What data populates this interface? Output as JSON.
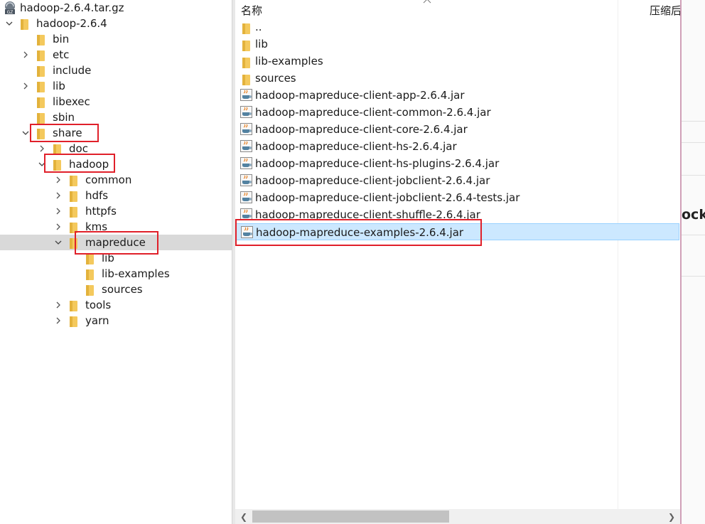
{
  "tree": {
    "root": "hadoop-2.6.4.tar.gz",
    "items": [
      {
        "label": "hadoop-2.6.4",
        "level": 0,
        "expander": "open"
      },
      {
        "label": "bin",
        "level": 1,
        "expander": "none"
      },
      {
        "label": "etc",
        "level": 1,
        "expander": "closed"
      },
      {
        "label": "include",
        "level": 1,
        "expander": "none"
      },
      {
        "label": "lib",
        "level": 1,
        "expander": "closed"
      },
      {
        "label": "libexec",
        "level": 1,
        "expander": "none"
      },
      {
        "label": "sbin",
        "level": 1,
        "expander": "none"
      },
      {
        "label": "share",
        "level": 1,
        "expander": "open"
      },
      {
        "label": "doc",
        "level": 2,
        "expander": "closed"
      },
      {
        "label": "hadoop",
        "level": 2,
        "expander": "open"
      },
      {
        "label": "common",
        "level": 3,
        "expander": "closed"
      },
      {
        "label": "hdfs",
        "level": 3,
        "expander": "closed"
      },
      {
        "label": "httpfs",
        "level": 3,
        "expander": "closed"
      },
      {
        "label": "kms",
        "level": 3,
        "expander": "closed"
      },
      {
        "label": "mapreduce",
        "level": 3,
        "expander": "open",
        "selected": true
      },
      {
        "label": "lib",
        "level": 4,
        "expander": "none"
      },
      {
        "label": "lib-examples",
        "level": 4,
        "expander": "none"
      },
      {
        "label": "sources",
        "level": 4,
        "expander": "none"
      },
      {
        "label": "tools",
        "level": 3,
        "expander": "closed"
      },
      {
        "label": "yarn",
        "level": 3,
        "expander": "closed"
      }
    ]
  },
  "list": {
    "col_name": "名称",
    "col_compressed": "压缩后",
    "rows": [
      {
        "name": "..",
        "type": "folder"
      },
      {
        "name": "lib",
        "type": "folder"
      },
      {
        "name": "lib-examples",
        "type": "folder"
      },
      {
        "name": "sources",
        "type": "folder"
      },
      {
        "name": "hadoop-mapreduce-client-app-2.6.4.jar",
        "type": "jar"
      },
      {
        "name": "hadoop-mapreduce-client-common-2.6.4.jar",
        "type": "jar"
      },
      {
        "name": "hadoop-mapreduce-client-core-2.6.4.jar",
        "type": "jar"
      },
      {
        "name": "hadoop-mapreduce-client-hs-2.6.4.jar",
        "type": "jar"
      },
      {
        "name": "hadoop-mapreduce-client-hs-plugins-2.6.4.jar",
        "type": "jar"
      },
      {
        "name": "hadoop-mapreduce-client-jobclient-2.6.4.jar",
        "type": "jar"
      },
      {
        "name": "hadoop-mapreduce-client-jobclient-2.6.4-tests.jar",
        "type": "jar"
      },
      {
        "name": "hadoop-mapreduce-client-shuffle-2.6.4.jar",
        "type": "jar"
      },
      {
        "name": "hadoop-mapreduce-examples-2.6.4.jar",
        "type": "jar",
        "selected": true
      }
    ]
  },
  "right_edge_text": "ock",
  "colors": {
    "highlight": "#e0202a",
    "tree_selected": "#d9d9d9",
    "list_selected": "#cce8ff",
    "folder": "#f4c95d"
  }
}
